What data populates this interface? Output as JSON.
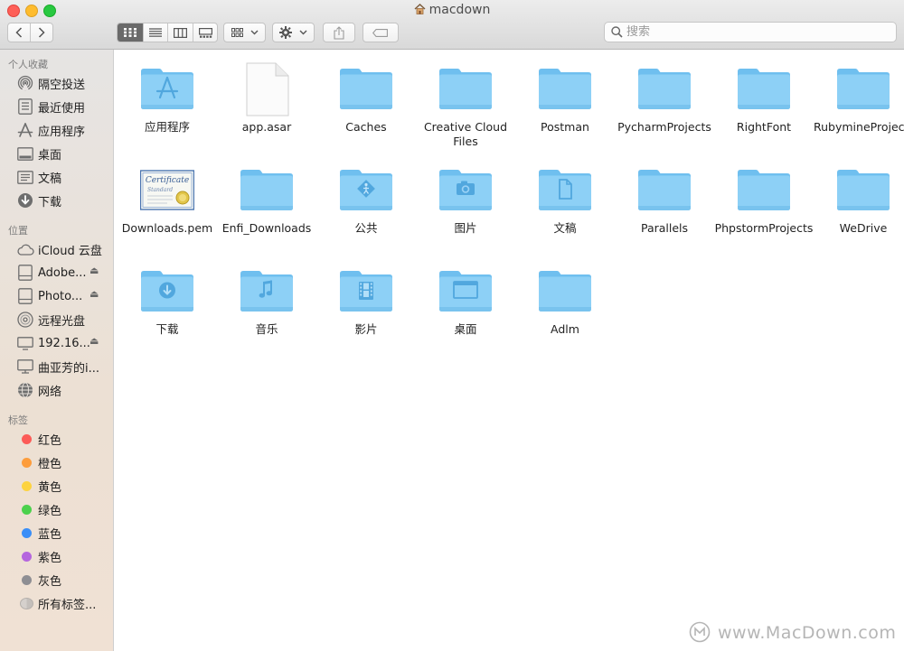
{
  "window": {
    "title": "macdown"
  },
  "toolbar": {
    "back": "‹",
    "forward": "›",
    "search_placeholder": "搜索"
  },
  "sidebar": {
    "favorites_title": "个人收藏",
    "favorites": [
      {
        "label": "隔空投送",
        "icon": "airdrop-icon"
      },
      {
        "label": "最近使用",
        "icon": "recents-icon"
      },
      {
        "label": "应用程序",
        "icon": "applications-icon"
      },
      {
        "label": "桌面",
        "icon": "desktop-icon"
      },
      {
        "label": "文稿",
        "icon": "documents-icon"
      },
      {
        "label": "下载",
        "icon": "downloads-icon"
      }
    ],
    "locations_title": "位置",
    "locations": [
      {
        "label": "iCloud 云盘",
        "icon": "icloud-icon",
        "eject": false
      },
      {
        "label": "Adobe...",
        "icon": "disk-icon",
        "eject": true
      },
      {
        "label": "Photo...",
        "icon": "disk-icon",
        "eject": true
      },
      {
        "label": "远程光盘",
        "icon": "optical-disc-icon",
        "eject": false
      },
      {
        "label": "192.16...",
        "icon": "display-icon",
        "eject": true
      },
      {
        "label": "曲亚芳的i...",
        "icon": "computer-icon",
        "eject": false
      },
      {
        "label": "网络",
        "icon": "network-icon",
        "eject": false
      }
    ],
    "tags_title": "标签",
    "tags": [
      {
        "label": "红色",
        "color": "#fc5b57"
      },
      {
        "label": "橙色",
        "color": "#fd9d3c"
      },
      {
        "label": "黄色",
        "color": "#fdd33f"
      },
      {
        "label": "绿色",
        "color": "#4cd14c"
      },
      {
        "label": "蓝色",
        "color": "#3a8ef7"
      },
      {
        "label": "紫色",
        "color": "#b566de"
      },
      {
        "label": "灰色",
        "color": "#8e8e93"
      },
      {
        "label": "所有标签...",
        "color": "all"
      }
    ]
  },
  "files": [
    {
      "name": "应用程序",
      "type": "folder",
      "glyph": "applications"
    },
    {
      "name": "app.asar",
      "type": "document",
      "glyph": ""
    },
    {
      "name": "Caches",
      "type": "folder",
      "glyph": ""
    },
    {
      "name": "Creative Cloud Files",
      "type": "folder",
      "glyph": ""
    },
    {
      "name": "Postman",
      "type": "folder",
      "glyph": ""
    },
    {
      "name": "PycharmProjects",
      "type": "folder",
      "glyph": ""
    },
    {
      "name": "RightFont",
      "type": "folder",
      "glyph": ""
    },
    {
      "name": "RubymineProjects",
      "type": "folder",
      "glyph": ""
    },
    {
      "name": "Downloads.pem",
      "type": "certificate",
      "glyph": ""
    },
    {
      "name": "Enfi_Downloads",
      "type": "folder",
      "glyph": ""
    },
    {
      "name": "公共",
      "type": "folder",
      "glyph": "public"
    },
    {
      "name": "图片",
      "type": "folder",
      "glyph": "pictures"
    },
    {
      "name": "文稿",
      "type": "folder",
      "glyph": "documents"
    },
    {
      "name": "Parallels",
      "type": "folder",
      "glyph": ""
    },
    {
      "name": "PhpstormProjects",
      "type": "folder",
      "glyph": ""
    },
    {
      "name": "WeDrive",
      "type": "folder",
      "glyph": ""
    },
    {
      "name": "下载",
      "type": "folder",
      "glyph": "downloads"
    },
    {
      "name": "音乐",
      "type": "folder",
      "glyph": "music"
    },
    {
      "name": "影片",
      "type": "folder",
      "glyph": "movies"
    },
    {
      "name": "桌面",
      "type": "folder",
      "glyph": "desktop"
    },
    {
      "name": "Adlm",
      "type": "folder",
      "glyph": ""
    }
  ],
  "certificate": {
    "line1": "Certificate",
    "line2": "Standard"
  },
  "watermark": {
    "text": "www.MacDown.com"
  }
}
